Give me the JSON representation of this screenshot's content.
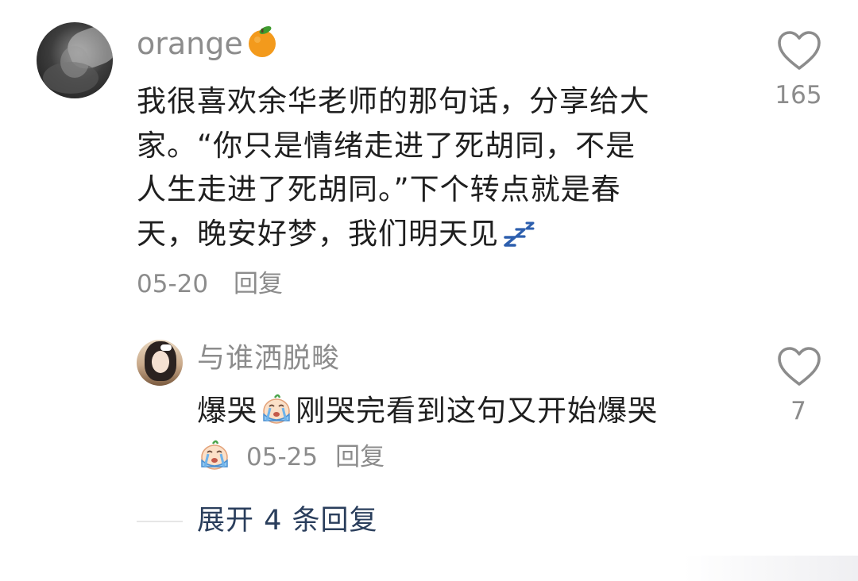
{
  "comment": {
    "username": "orange",
    "username_emoji": "orange-emoji",
    "text_lines": [
      "我很喜欢余华老师的那句话，分享给大",
      "家。“你只是情绪走进了死胡同，不是",
      "人生走进了死胡同。”下个转点就是春",
      "天，晚安好梦，我们明天见"
    ],
    "trailing_emoji": "zzz-icon",
    "date": "05-20",
    "reply_label": "回复",
    "like_icon": "heart-outline-icon",
    "like_count": "165"
  },
  "reply": {
    "username": "与谁洒脱畯",
    "text_before_emoji": "爆哭",
    "text_after_emoji": "刚哭完看到这句又开始爆哭",
    "inline_emoji": "crying-emoji",
    "date": "05-25",
    "reply_label": "回复",
    "like_icon": "heart-outline-icon",
    "like_count": "7"
  },
  "expand": {
    "label": "展开 4 条回复"
  },
  "colors": {
    "meta_gray": "#8c8c8c",
    "text": "#1f1f1f",
    "link": "#2a3e5c",
    "orange": "#f39a1c"
  }
}
